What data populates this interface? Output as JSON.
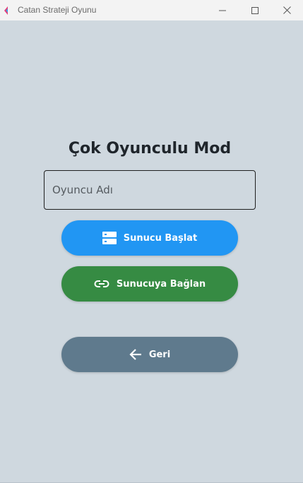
{
  "window": {
    "title": "Catan Strateji Oyunu",
    "minimize_icon": "minimize-icon",
    "maximize_icon": "maximize-icon",
    "close_icon": "close-icon"
  },
  "screen": {
    "heading": "Çok Oyunculu Mod",
    "name_input": {
      "placeholder": "Oyuncu Adı",
      "value": ""
    },
    "buttons": {
      "host": {
        "label": "Sunucu Başlat",
        "icon": "server-icon",
        "color": "#2196f3"
      },
      "join": {
        "label": "Sunucuya Bağlan",
        "icon": "link-icon",
        "color": "#368b43"
      },
      "back": {
        "label": "Geri",
        "icon": "arrow-left-icon",
        "color": "#5f7a8d"
      }
    }
  },
  "colors": {
    "background": "#cfd8df",
    "titlebar": "#f3f3f3",
    "heading": "#1f252b"
  }
}
